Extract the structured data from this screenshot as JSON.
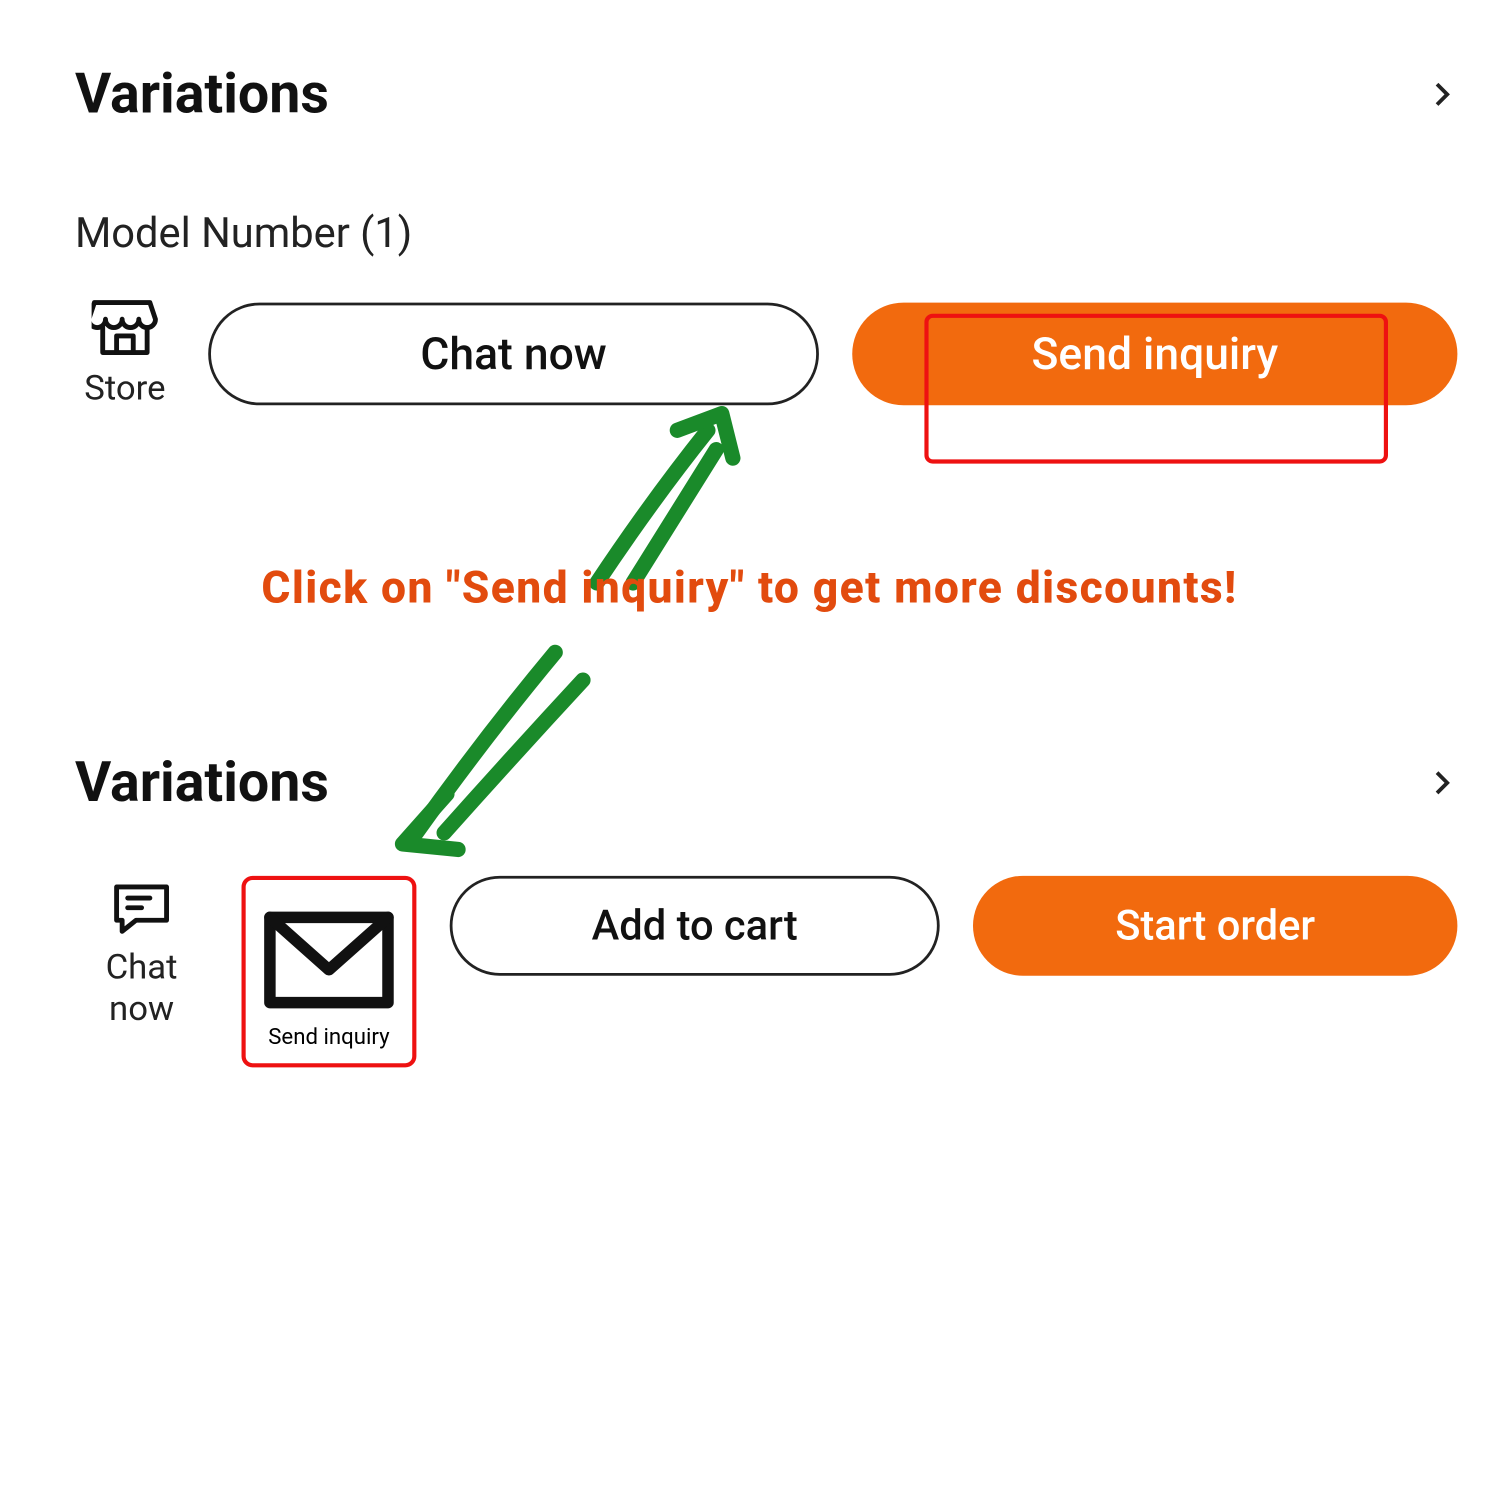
{
  "section1": {
    "title": "Variations",
    "model_number": "Model Number (1)",
    "store_label": "Store",
    "chat_now": "Chat now",
    "send_inquiry": "Send inquiry"
  },
  "annotation": {
    "text": "Click on \"Send inquiry\" to get more discounts!"
  },
  "section2": {
    "title": "Variations",
    "chat_now": "Chat now",
    "send_inquiry": "Send inquiry",
    "add_to_cart": "Add to cart",
    "start_order": "Start order"
  },
  "colors": {
    "accent": "#f26a0e",
    "annotation_red": "#e11",
    "arrow_green": "#1a8a2a"
  }
}
